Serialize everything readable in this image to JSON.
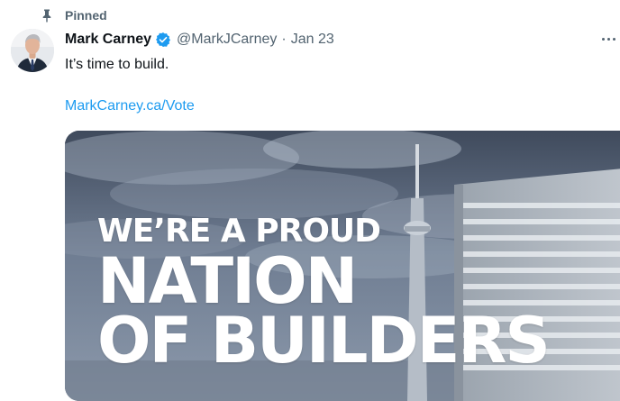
{
  "pinned": {
    "label": "Pinned",
    "icon": "pin-icon"
  },
  "author": {
    "display_name": "Mark Carney",
    "handle": "@MarkJCarney",
    "separator": "·",
    "date": "Jan 23",
    "verified_icon": "verified-badge-icon",
    "verified_color": "#1d9bf0"
  },
  "tweet": {
    "text": "It’s time to build.",
    "link": "MarkCarney.ca/Vote"
  },
  "media": {
    "line1": "WE’RE A PROUD",
    "line2": "NATION",
    "line3": "OF BUILDERS"
  },
  "colors": {
    "link": "#1d9bf0",
    "muted": "#536471",
    "text": "#0f1419"
  }
}
